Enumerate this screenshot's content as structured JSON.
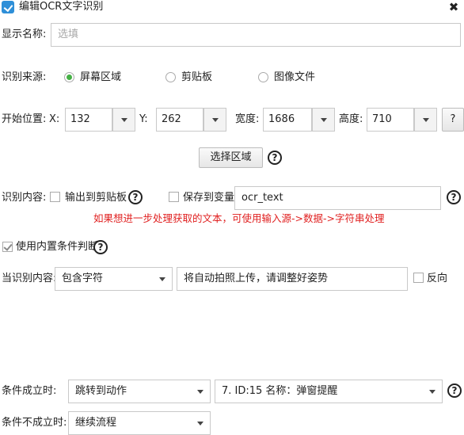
{
  "window": {
    "title": "编辑OCR文字识别",
    "close_glyph": "✖"
  },
  "display_name": {
    "label": "显示名称:",
    "placeholder": "选填"
  },
  "source": {
    "label": "识别来源:",
    "options": [
      "屏幕区域",
      "剪贴板",
      "图像文件"
    ],
    "selected": "屏幕区域"
  },
  "position": {
    "label": "开始位置:",
    "x_label": "X:",
    "x_value": "132",
    "y_label": "Y:",
    "y_value": "262",
    "width_label": "宽度:",
    "width_value": "1686",
    "height_label": "高度:",
    "height_value": "710",
    "help_label": "?"
  },
  "select_area_button": "选择区域",
  "content": {
    "label": "识别内容:",
    "clipboard_label": "输出到剪贴板",
    "clipboard_checked": false,
    "save_var_label": "保存到变量:",
    "save_var_checked": false,
    "var_value": "ocr_text",
    "hint": "如果想进一步处理获取的文本，可使用输入源->数据->字符串处理"
  },
  "builtin_condition": {
    "label": "使用内置条件判断",
    "checked": true
  },
  "condition": {
    "label": "当识别内容:",
    "operator": "包含字符",
    "value": "将自动拍照上传，请调整好姿势",
    "reverse_label": "反向",
    "reverse_checked": false
  },
  "on_true": {
    "label": "条件成立时:",
    "action": "跳转到动作",
    "target": "7. ID:15 名称：弹窗提醒"
  },
  "on_false": {
    "label": "条件不成立时:",
    "action": "继续流程"
  },
  "help_glyph": "?",
  "colors": {
    "hint_red": "#e02020",
    "radio_green": "#45b045",
    "app_icon_blue": "#2e8fd8"
  },
  "icons": {
    "app": "app-logo-icon",
    "close": "close-icon",
    "help": "help-icon",
    "dropdown": "chevron-down-icon"
  }
}
